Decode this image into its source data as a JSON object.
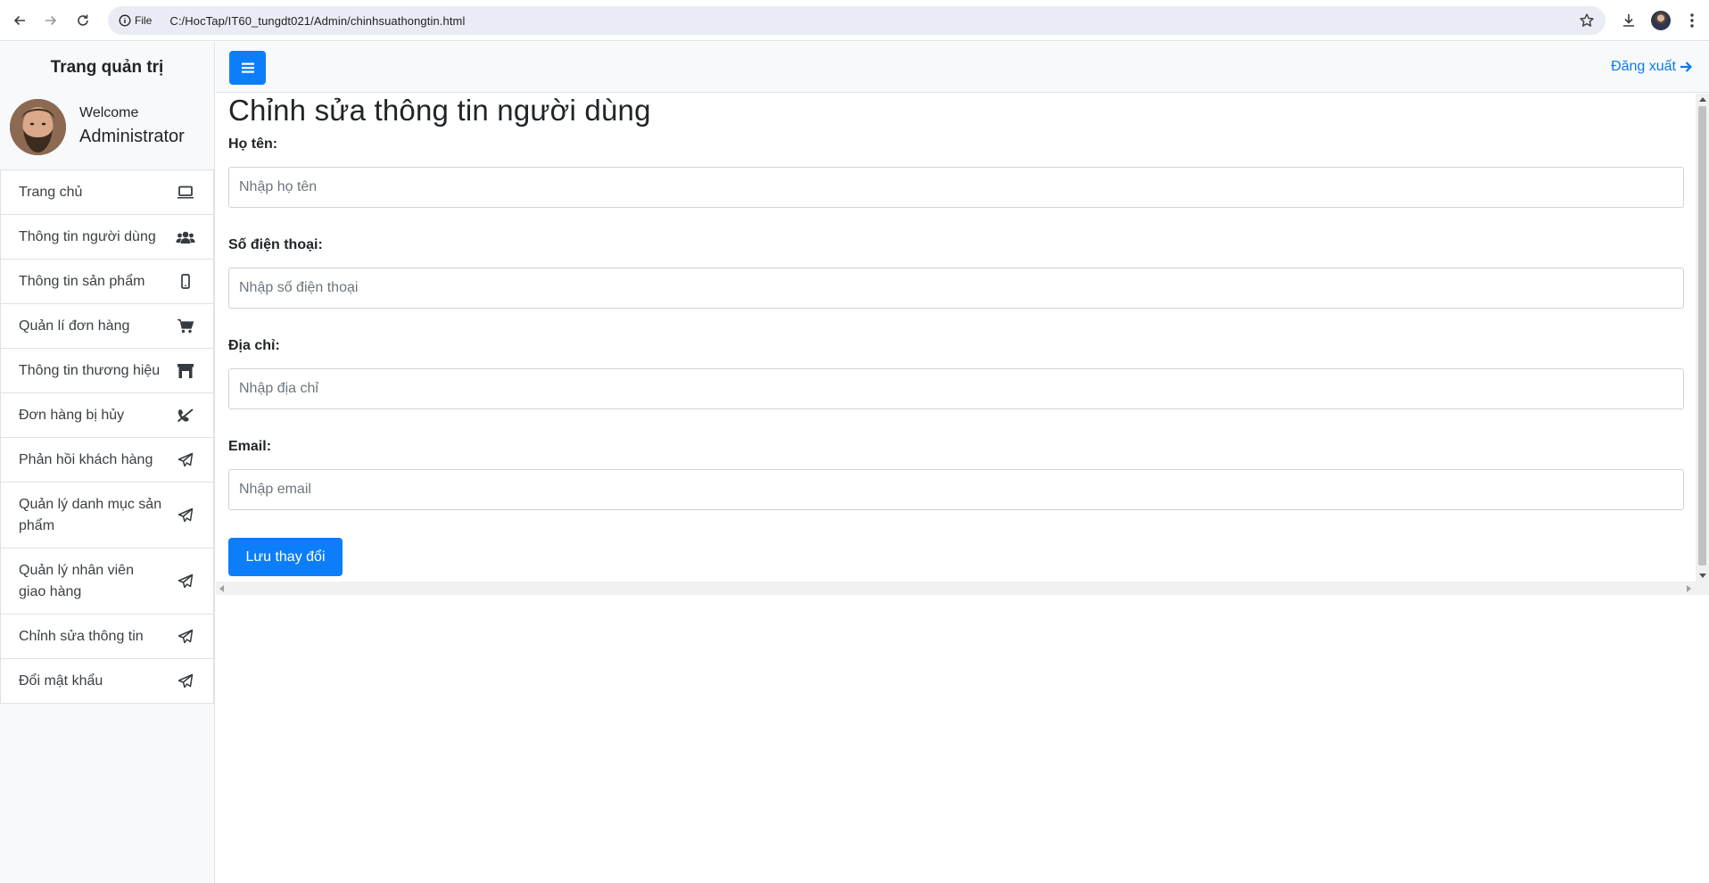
{
  "browser": {
    "site_chip_label": "File",
    "url": "C:/HocTap/IT60_tungdt021/Admin/chinhsuathongtin.html"
  },
  "sidebar": {
    "brand": "Trang quản trị",
    "welcome": "Welcome",
    "user_name": "Administrator",
    "items": [
      {
        "label": "Trang chủ",
        "icon": "laptop-icon"
      },
      {
        "label": "Thông tin người dùng",
        "icon": "users-icon"
      },
      {
        "label": "Thông tin sản phẩm",
        "icon": "mobile-icon"
      },
      {
        "label": "Quản lí đơn hàng",
        "icon": "cart-icon"
      },
      {
        "label": "Thông tin thương hiệu",
        "icon": "store-icon"
      },
      {
        "label": "Đơn hàng bị hủy",
        "icon": "phone-slash-icon"
      },
      {
        "label": "Phản hồi khách hàng",
        "icon": "paper-plane-icon"
      },
      {
        "label": "Quản lý danh mục sản phẩm",
        "icon": "paper-plane-icon"
      },
      {
        "label": "Quản lý nhân viên giao hàng",
        "icon": "paper-plane-icon"
      },
      {
        "label": "Chỉnh sửa thông tin",
        "icon": "paper-plane-icon"
      },
      {
        "label": "Đổi mật khẩu",
        "icon": "paper-plane-icon"
      }
    ]
  },
  "topbar": {
    "logout_label": "Đăng xuất"
  },
  "form": {
    "title": "Chỉnh sửa thông tin người dùng",
    "fields": [
      {
        "label": "Họ tên:",
        "placeholder": "Nhập họ tên",
        "value": ""
      },
      {
        "label": "Số điện thoại:",
        "placeholder": "Nhập số điện thoại",
        "value": ""
      },
      {
        "label": "Địa chỉ:",
        "placeholder": "Nhập địa chỉ",
        "value": ""
      },
      {
        "label": "Email:",
        "placeholder": "Nhập email",
        "value": ""
      }
    ],
    "submit_label": "Lưu thay đổi"
  },
  "colors": {
    "primary": "#0d7ef9",
    "sidebar_bg": "#f8f9fa",
    "link": "#0a7cf0"
  }
}
